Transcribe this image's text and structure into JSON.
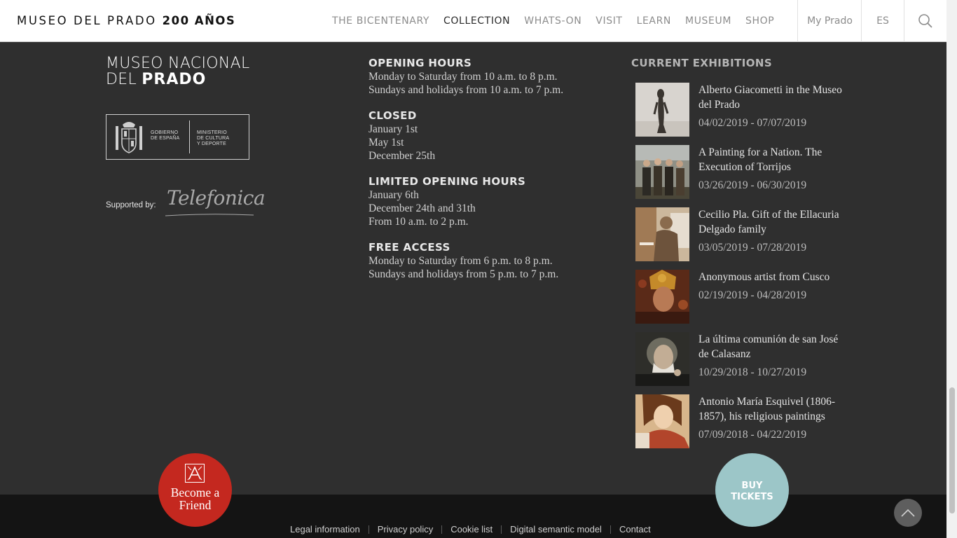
{
  "header": {
    "logo_main": "MUSEO DEL PRADO",
    "logo_bold": "200 AÑOS",
    "nav": [
      {
        "label": "THE BICENTENARY"
      },
      {
        "label": "COLLECTION"
      },
      {
        "label": "WHATS-ON"
      },
      {
        "label": "VISIT"
      },
      {
        "label": "LEARN"
      },
      {
        "label": "MUSEUM"
      },
      {
        "label": "SHOP"
      }
    ],
    "my_prado": "My Prado",
    "language": "ES",
    "search_icon": "search-icon"
  },
  "museum_logo": {
    "line1": "MUSEO NACIONAL",
    "line2_light": "DEL",
    "line2_bold": "PRADO"
  },
  "government": {
    "gobierno": [
      "GOBIERNO",
      "DE ESPAÑA"
    ],
    "ministerio": [
      "MINISTERIO",
      "DE CULTURA",
      "Y DEPORTE"
    ]
  },
  "sponsor": {
    "supported_by": "Supported by:",
    "brand": "Telefonica"
  },
  "info": [
    {
      "heading": "OPENING HOURS",
      "lines": [
        "Monday to Saturday from 10 a.m. to 8 p.m.",
        "Sundays and holidays from 10 a.m. to 7 p.m."
      ]
    },
    {
      "heading": "CLOSED",
      "lines": [
        "January 1st",
        "May 1st",
        "December 25th"
      ]
    },
    {
      "heading": "LIMITED OPENING HOURS",
      "lines": [
        "January 6th",
        "December 24th and 31th",
        "From 10 a.m. to 2 p.m."
      ]
    },
    {
      "heading": "FREE ACCESS",
      "lines": [
        "Monday to Saturday from 6 p.m. to 8 p.m.",
        "Sundays and holidays from 5 p.m. to 7 p.m."
      ]
    }
  ],
  "exhibitions": {
    "title": "CURRENT EXHIBITIONS",
    "items": [
      {
        "name": "Alberto Giacometti in the Museo del Prado",
        "dates": "04/02/2019 - 07/07/2019"
      },
      {
        "name": "A Painting for a Nation. The Execution of Torrijos",
        "dates": "03/26/2019 - 06/30/2019"
      },
      {
        "name": "Cecilio Pla. Gift of the Ellacuria Delgado family",
        "dates": "03/05/2019 - 07/28/2019"
      },
      {
        "name": "Anonymous artist from Cusco",
        "dates": "02/19/2019 - 04/28/2019"
      },
      {
        "name": "La última comunión de san José de Calasanz",
        "dates": "10/29/2018 - 10/27/2019"
      },
      {
        "name": "Antonio María Esquivel (1806-1857), his religious paintings",
        "dates": "07/09/2018 - 04/22/2019"
      }
    ]
  },
  "buttons": {
    "friend_line1": "Become a",
    "friend_line2": "Friend",
    "tickets_line1": "BUY",
    "tickets_line2": "TICKETS"
  },
  "footer": {
    "links": [
      "Legal information",
      "Privacy policy",
      "Cookie list",
      "Digital semantic model",
      "Contact"
    ]
  },
  "colors": {
    "background": "#2f2f2f",
    "friend_red": "#c4281f",
    "tickets_teal": "#9cc6c8",
    "footer": "#141414"
  }
}
